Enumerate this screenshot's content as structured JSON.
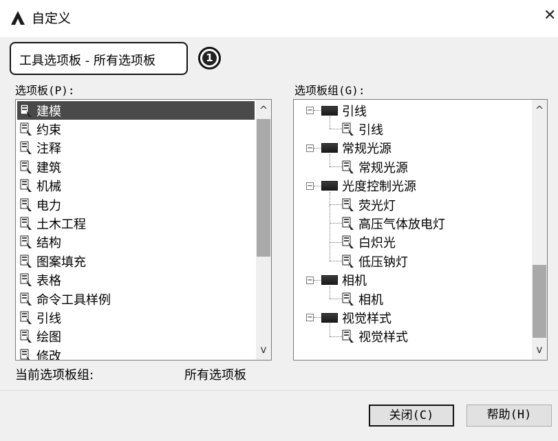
{
  "window": {
    "title": "自定义",
    "close_glyph": "✕"
  },
  "tab": {
    "label": "工具选项板 - 所有选项板",
    "badge": "1"
  },
  "palettes": {
    "label": "选项板(P):",
    "items": [
      "建模",
      "约束",
      "注释",
      "建筑",
      "机械",
      "电力",
      "土木工程",
      "结构",
      "图案填充",
      "表格",
      "命令工具样例",
      "引线",
      "绘图",
      "修改"
    ],
    "selected_index": 0
  },
  "groups": {
    "label": "选项板组(G):",
    "tree": [
      {
        "name": "引线",
        "children": [
          "引线"
        ]
      },
      {
        "name": "常规光源",
        "children": [
          "常规光源"
        ]
      },
      {
        "name": "光度控制光源",
        "children": [
          "荧光灯",
          "高压气体放电灯",
          "白炽光",
          "低压钠灯"
        ]
      },
      {
        "name": "相机",
        "children": [
          "相机"
        ]
      },
      {
        "name": "视觉样式",
        "children": [
          "视觉样式"
        ]
      }
    ]
  },
  "status": {
    "label": "当前选项板组:",
    "value": "所有选项板"
  },
  "buttons": {
    "close": "关闭(C)",
    "help": "帮助(H)"
  },
  "scroll": {
    "up": "^",
    "down": "v"
  },
  "colors": {
    "selection": "#4a4a4a",
    "dialog_bg": "#f0f0f0"
  }
}
